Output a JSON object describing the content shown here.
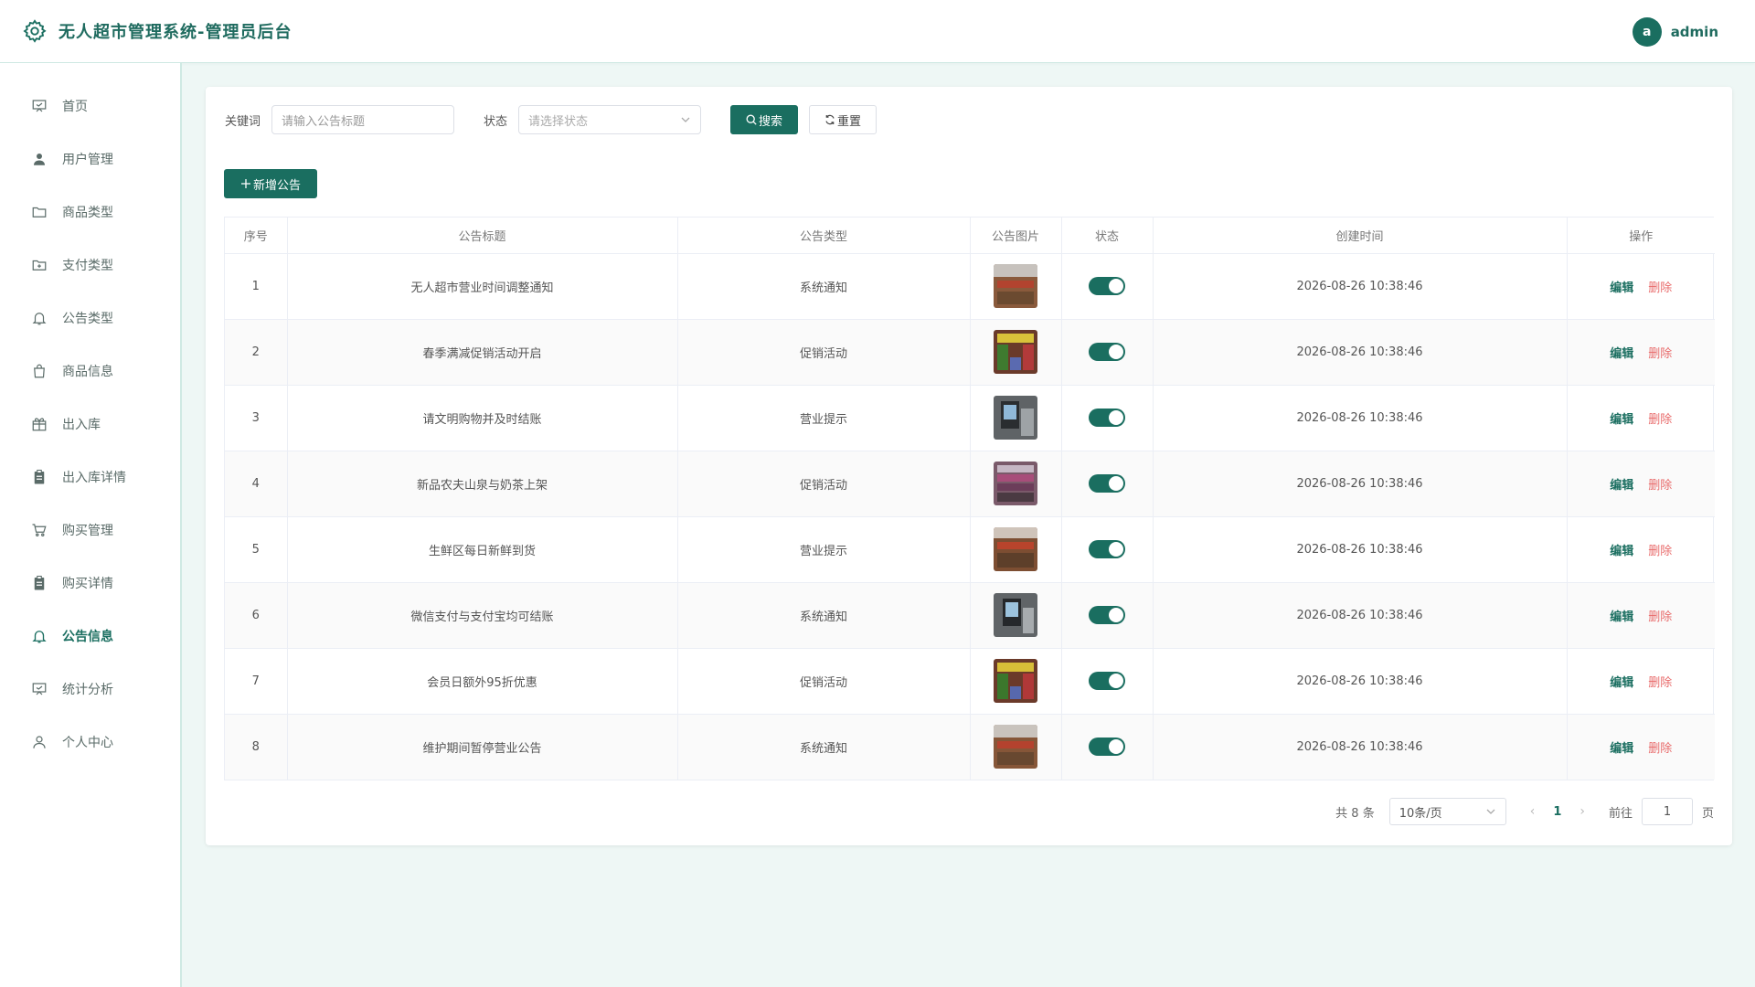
{
  "header": {
    "title": "无人超市管理系统-管理员后台",
    "avatar_letter": "a",
    "username": "admin"
  },
  "sidebar": {
    "items": [
      {
        "label": "首页",
        "icon": "presentation-icon"
      },
      {
        "label": "用户管理",
        "icon": "user-icon"
      },
      {
        "label": "商品类型",
        "icon": "folder-icon"
      },
      {
        "label": "支付类型",
        "icon": "folder-add-icon"
      },
      {
        "label": "公告类型",
        "icon": "bell-icon"
      },
      {
        "label": "商品信息",
        "icon": "shopping-bag-icon"
      },
      {
        "label": "出入库",
        "icon": "gift-box-icon"
      },
      {
        "label": "出入库详情",
        "icon": "clipboard-icon"
      },
      {
        "label": "购买管理",
        "icon": "cart-icon"
      },
      {
        "label": "购买详情",
        "icon": "clipboard-icon"
      },
      {
        "label": "公告信息",
        "icon": "bell-icon",
        "active": true
      },
      {
        "label": "统计分析",
        "icon": "presentation-icon"
      },
      {
        "label": "个人中心",
        "icon": "user-outline-icon"
      }
    ]
  },
  "filter": {
    "keyword_label": "关键词",
    "keyword_placeholder": "请输入公告标题",
    "status_label": "状态",
    "status_placeholder": "请选择状态",
    "search_label": "搜索",
    "reset_label": "重置"
  },
  "add_button_label": "新增公告",
  "table": {
    "headers": [
      "序号",
      "公告标题",
      "公告类型",
      "公告图片",
      "状态",
      "创建时间",
      "操作"
    ],
    "edit_label": "编辑",
    "delete_label": "删除",
    "rows": [
      {
        "index": "1",
        "title": "无人超市营业时间调整通知",
        "type": "系统通知",
        "status": true,
        "created": "2026-08-26 10:38:46"
      },
      {
        "index": "2",
        "title": "春季满减促销活动开启",
        "type": "促销活动",
        "status": true,
        "created": "2026-08-26 10:38:46"
      },
      {
        "index": "3",
        "title": "请文明购物并及时结账",
        "type": "营业提示",
        "status": true,
        "created": "2026-08-26 10:38:46"
      },
      {
        "index": "4",
        "title": "新品农夫山泉与奶茶上架",
        "type": "促销活动",
        "status": true,
        "created": "2026-08-26 10:38:46"
      },
      {
        "index": "5",
        "title": "生鲜区每日新鲜到货",
        "type": "营业提示",
        "status": true,
        "created": "2026-08-26 10:38:46"
      },
      {
        "index": "6",
        "title": "微信支付与支付宝均可结账",
        "type": "系统通知",
        "status": true,
        "created": "2026-08-26 10:38:46"
      },
      {
        "index": "7",
        "title": "会员日额外95折优惠",
        "type": "促销活动",
        "status": true,
        "created": "2026-08-26 10:38:46"
      },
      {
        "index": "8",
        "title": "维护期间暂停营业公告",
        "type": "系统通知",
        "status": true,
        "created": "2026-08-26 10:38:46"
      }
    ]
  },
  "pagination": {
    "total_text": "共 8 条",
    "page_size": "10条/页",
    "current_page": "1",
    "goto_label": "前往",
    "goto_value": "1",
    "page_suffix": "页"
  },
  "colors": {
    "primary": "#1a6e60",
    "danger": "#e86a6a",
    "background": "#eef7f5"
  }
}
